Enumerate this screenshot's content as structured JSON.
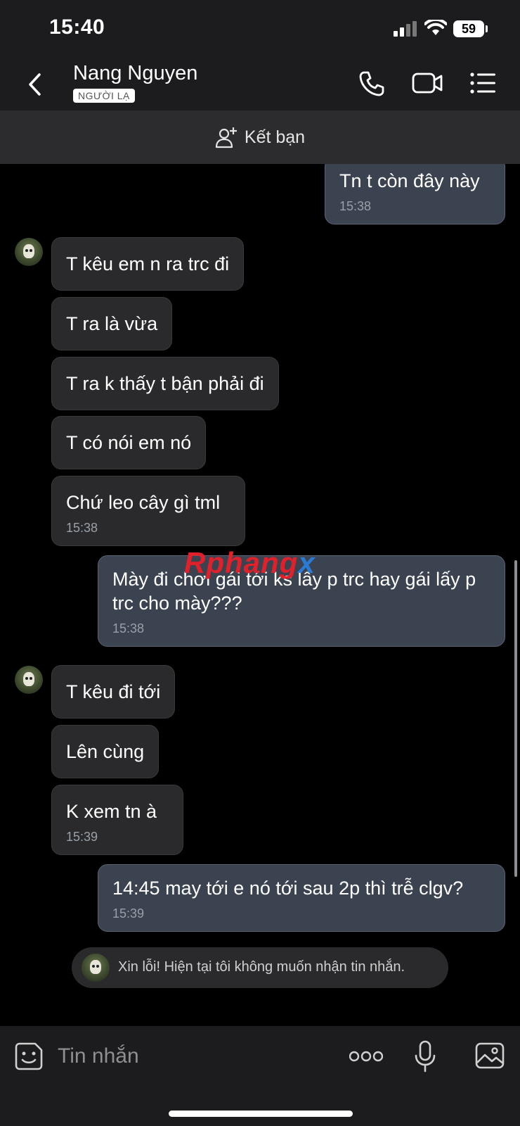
{
  "status_bar": {
    "time": "15:40",
    "battery": "59"
  },
  "header": {
    "contact_name": "Nang Nguyen",
    "badge": "NGƯỜI LẠ"
  },
  "friend_bar": {
    "label": "Kết bạn"
  },
  "messages": [
    {
      "side": "out",
      "text": "Tn t còn đây này",
      "time": "15:38"
    },
    {
      "side": "in",
      "text": "T kêu em n ra trc đi"
    },
    {
      "side": "in",
      "text": "T ra là vừa"
    },
    {
      "side": "in",
      "text": "T ra k thấy t bận phải đi"
    },
    {
      "side": "in",
      "text": "T có nói em nó"
    },
    {
      "side": "in",
      "text": "Chứ leo cây gì tml",
      "time": "15:38"
    },
    {
      "side": "out",
      "text": "Mày đi chơi gái tới ks lấy p trc hay gái lấy p trc cho mày???",
      "time": "15:38"
    },
    {
      "side": "in",
      "text": "T kêu đi tới"
    },
    {
      "side": "in",
      "text": "Lên cùng"
    },
    {
      "side": "in",
      "text": "K xem tn à",
      "time": "15:39"
    },
    {
      "side": "out",
      "text": "14:45 may tới e nó tới sau 2p thì trễ clgv?",
      "time": "15:39"
    }
  ],
  "system_notice": "Xin lỗi! Hiện tại tôi không muốn nhận tin nhắn.",
  "watermark": {
    "part1": "Rphang",
    "part2": "x"
  },
  "composer": {
    "placeholder": "Tin nhắn"
  },
  "icons": {
    "back": "chevron-left-icon",
    "call": "phone-icon",
    "video": "video-camera-icon",
    "menu": "list-menu-icon",
    "add_friend": "person-add-icon",
    "sticker": "sticker-smiley-icon",
    "more": "more-dots-icon",
    "mic": "microphone-icon",
    "image": "image-gallery-icon"
  },
  "colors": {
    "incoming_bubble": "#2a2a2c",
    "outgoing_bubble": "#3b4250",
    "background": "#000000",
    "bars": "#1c1c1e"
  }
}
